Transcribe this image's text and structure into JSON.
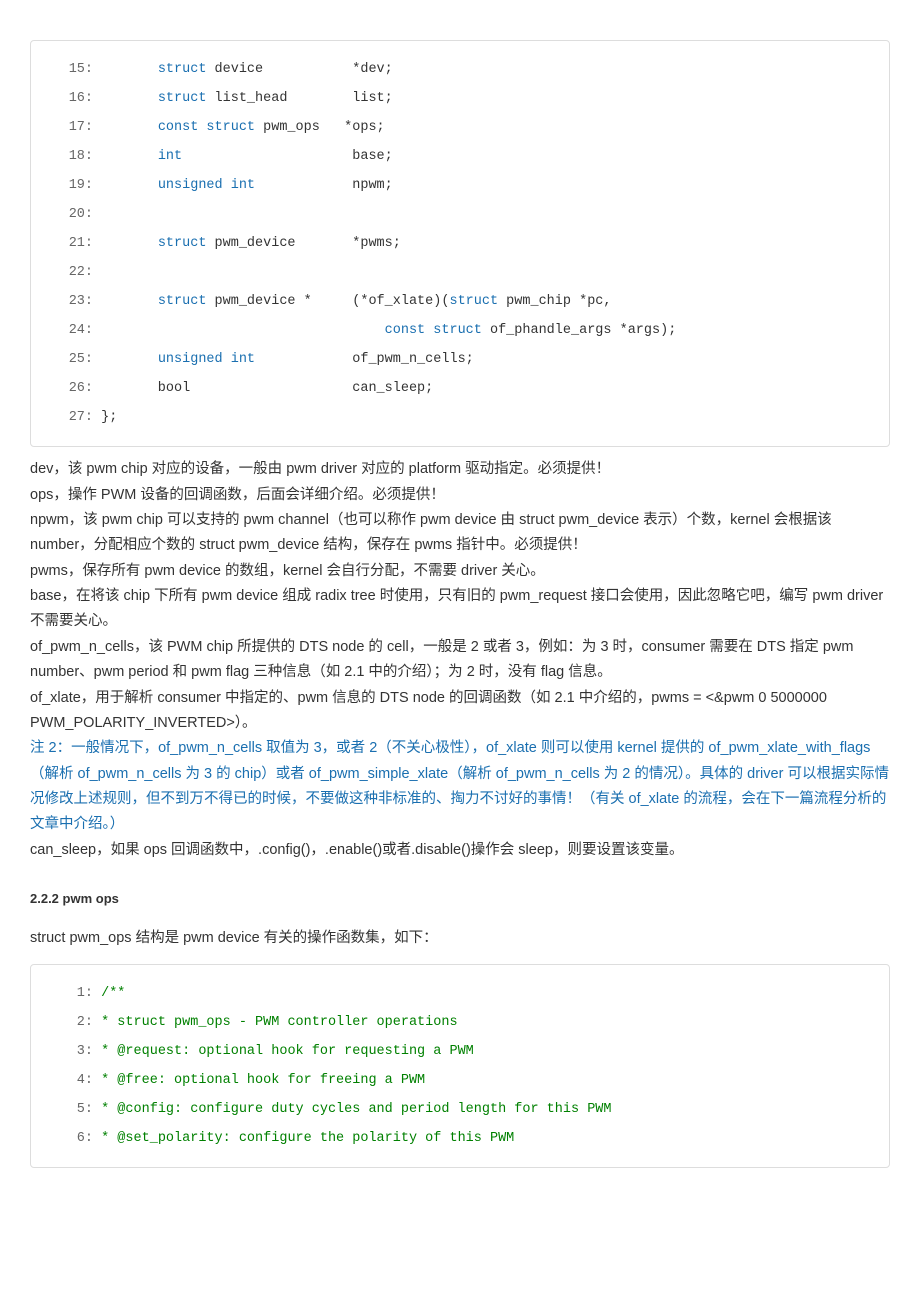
{
  "code1": {
    "lines": [
      {
        "n": "15:",
        "html": "        <span class='kw'>struct</span> device           *dev;"
      },
      {
        "n": "16:",
        "html": "        <span class='kw'>struct</span> list_head        list;"
      },
      {
        "n": "17:",
        "html": "        <span class='kw'>const struct</span> pwm_ops   *ops;"
      },
      {
        "n": "18:",
        "html": "        <span class='kw'>int</span>                     base;"
      },
      {
        "n": "19:",
        "html": "        <span class='kw'>unsigned int</span>            npwm;"
      },
      {
        "n": "20:",
        "html": ""
      },
      {
        "n": "21:",
        "html": "        <span class='kw'>struct</span> pwm_device       *pwms;"
      },
      {
        "n": "22:",
        "html": ""
      },
      {
        "n": "23:",
        "html": "        <span class='kw'>struct</span> pwm_device *     (*of_xlate)(<span class='kw'>struct</span> pwm_chip *pc,"
      },
      {
        "n": "24:",
        "html": "                                    <span class='kw'>const struct</span> of_phandle_args *args);"
      },
      {
        "n": "25:",
        "html": "        <span class='kw'>unsigned int</span>            of_pwm_n_cells;"
      },
      {
        "n": "26:",
        "html": "        bool                    can_sleep;"
      },
      {
        "n": "27:",
        "html": " };"
      }
    ]
  },
  "explain": {
    "p1": "dev，该 pwm chip 对应的设备，一般由 pwm driver 对应的 platform 驱动指定。必须提供！",
    "p2": "ops，操作 PWM 设备的回调函数，后面会详细介绍。必须提供！",
    "p3": "npwm，该 pwm chip 可以支持的 pwm channel（也可以称作 pwm device 由 struct pwm_device 表示）个数，kernel 会根据该 number，分配相应个数的 struct pwm_device 结构，保存在 pwms 指针中。必须提供！",
    "p4": "pwms，保存所有 pwm device 的数组，kernel 会自行分配，不需要 driver 关心。",
    "p5": "base，在将该 chip 下所有 pwm device 组成 radix tree 时使用，只有旧的 pwm_request 接口会使用，因此忽略它吧，编写 pwm driver 不需要关心。",
    "p6": "of_pwm_n_cells，该 PWM chip 所提供的 DTS node 的 cell，一般是 2 或者 3，例如：为 3 时，consumer 需要在 DTS 指定 pwm number、pwm period 和 pwm flag 三种信息（如 2.1 中的介绍）；为 2 时，没有 flag 信息。",
    "p7": "of_xlate，用于解析 consumer 中指定的、pwm 信息的 DTS node 的回调函数（如 2.1 中介绍的，pwms = <&pwm 0 5000000 PWM_POLARITY_INVERTED>）。",
    "note": "注 2：一般情况下，of_pwm_n_cells 取值为 3，或者 2（不关心极性），of_xlate 则可以使用 kernel 提供的 of_pwm_xlate_with_flags（解析 of_pwm_n_cells 为 3 的 chip）或者 of_pwm_simple_xlate（解析 of_pwm_n_cells 为 2 的情况）。具体的 driver 可以根据实际情况修改上述规则，但不到万不得已的时候，不要做这种非标准的、掏力不讨好的事情！（有关 of_xlate 的流程，会在下一篇流程分析的文章中介绍。）",
    "p8": "can_sleep，如果 ops 回调函数中，.config()，.enable()或者.disable()操作会 sleep，则要设置该变量。"
  },
  "section": {
    "head": "2.2.2 pwm ops",
    "intro": "struct pwm_ops 结构是 pwm device 有关的操作函数集，如下："
  },
  "code2": {
    "lines": [
      {
        "n": "1:",
        "html": " <span class='comment'>/**</span>"
      },
      {
        "n": "2:",
        "html": " <span class='comment'>* struct pwm_ops - PWM controller operations</span>"
      },
      {
        "n": "3:",
        "html": " <span class='comment'>* @request: optional hook for requesting a PWM</span>"
      },
      {
        "n": "4:",
        "html": " <span class='comment'>* @free: optional hook for freeing a PWM</span>"
      },
      {
        "n": "5:",
        "html": " <span class='comment'>* @config: configure duty cycles and period length for this PWM</span>"
      },
      {
        "n": "6:",
        "html": " <span class='comment'>* @set_polarity: configure the polarity of this PWM</span>"
      }
    ]
  }
}
